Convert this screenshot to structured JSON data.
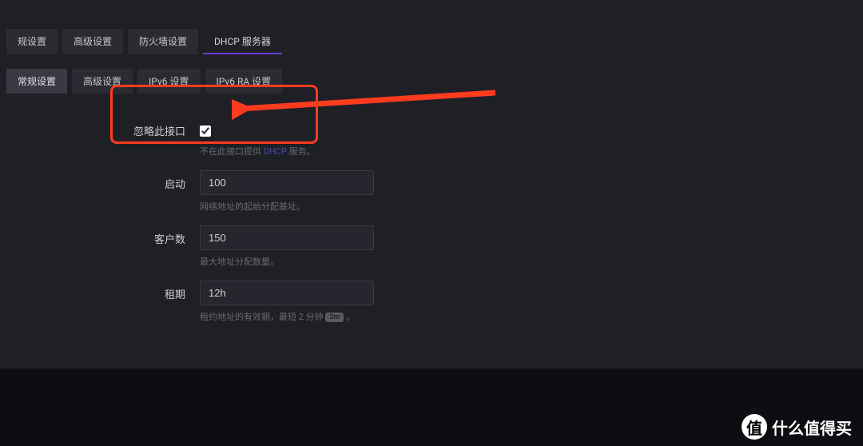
{
  "tabs": {
    "primary": [
      {
        "label": "规设置",
        "active": false
      },
      {
        "label": "高级设置",
        "active": false
      },
      {
        "label": "防火墙设置",
        "active": false
      },
      {
        "label": "DHCP 服务器",
        "active": true
      }
    ],
    "secondary": [
      {
        "label": "常规设置",
        "active": true
      },
      {
        "label": "高级设置",
        "active": false
      },
      {
        "label": "IPv6 设置",
        "active": false
      },
      {
        "label": "IPv6 RA 设置",
        "active": false
      }
    ]
  },
  "form": {
    "ignore_interface": {
      "label": "忽略此接口",
      "checked": true,
      "help_prefix": "不在此接口提供 ",
      "help_link": "DHCP",
      "help_suffix": " 服务。"
    },
    "start": {
      "label": "启动",
      "value": "100",
      "help": "网络地址的起始分配基址。"
    },
    "limit": {
      "label": "客户数",
      "value": "150",
      "help": "最大地址分配数量。"
    },
    "lease": {
      "label": "租期",
      "value": "12h",
      "help_prefix": "租约地址的有效期，最短 2 分钟 ",
      "help_badge": "2m",
      "help_suffix": " 。"
    }
  },
  "watermark": {
    "badge": "值",
    "text": "什么值得买"
  }
}
